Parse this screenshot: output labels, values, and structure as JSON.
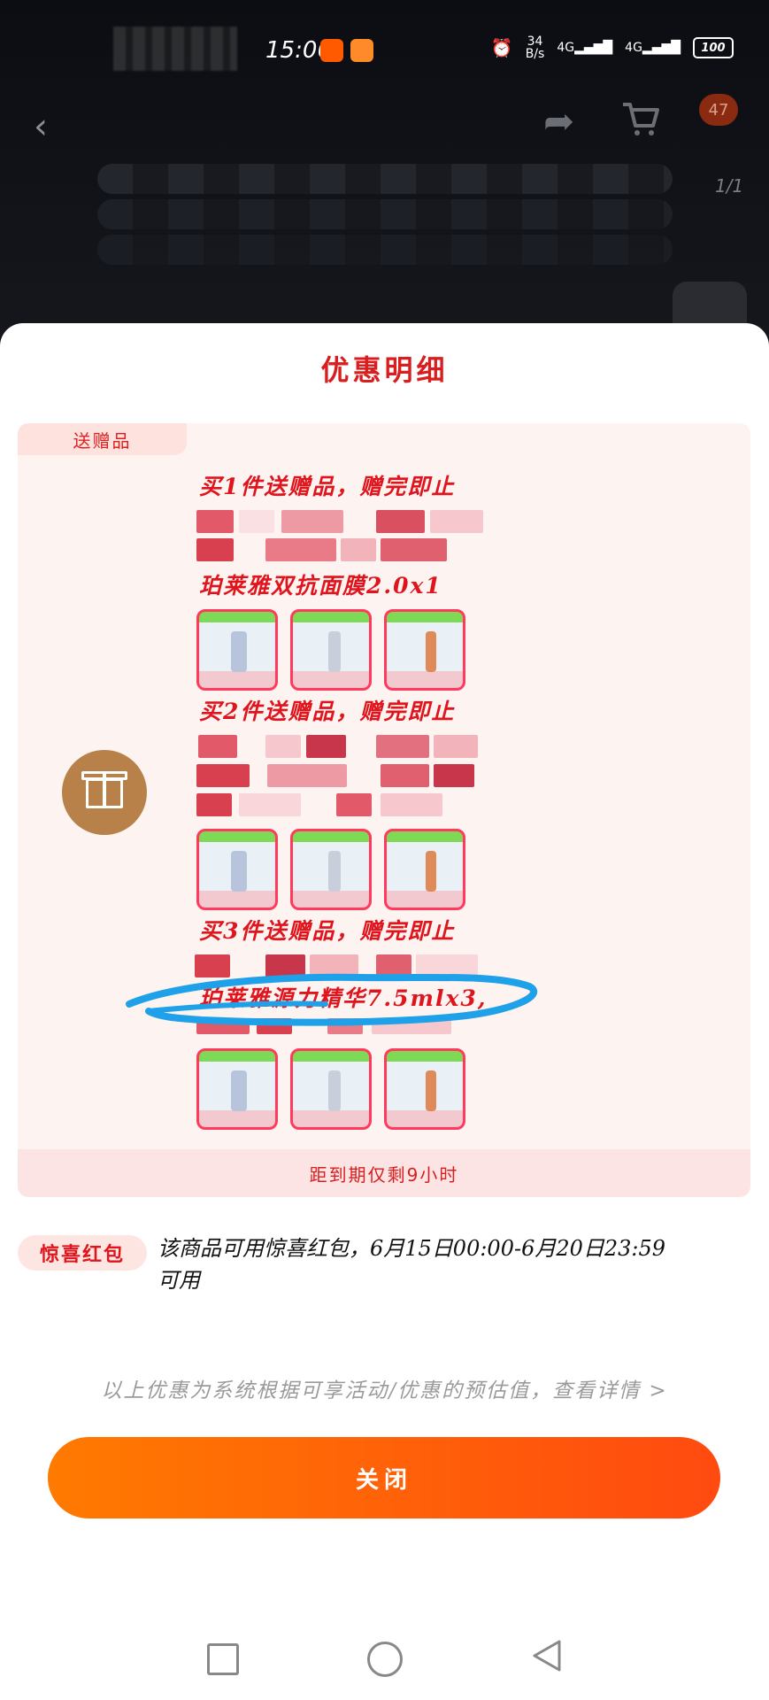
{
  "status_bar": {
    "time": "15:06",
    "net_speed": "34\nB/s",
    "signal_1": "4G",
    "signal_2": "4G",
    "battery": "100"
  },
  "nav": {
    "back_icon": "chevron-left-icon",
    "share_icon": "share-icon",
    "cart_icon": "cart-icon",
    "cart_badge": "47",
    "page_indicator": "1/1"
  },
  "sheet": {
    "title": "优惠明细",
    "gift_section": {
      "tag": "送赠品",
      "tier1_title": "买1件送赠品，赠完即止",
      "tier1_item": "珀莱雅双抗面膜2.0x1",
      "tier2_title": "买2件送赠品，赠完即止",
      "tier3_title": "买3件送赠品，赠完即止",
      "tier3_item": "珀莱雅源力精华7.5mlx3,",
      "footer": "距到期仅剩9小时"
    },
    "hongbao": {
      "tag": "惊喜红包",
      "text": "该商品可用惊喜红包，6月15日00:00-6月20日23:59可用"
    },
    "disclaimer": "以上优惠为系统根据可享活动/优惠的预估值，查看详情 >",
    "close_label": "关闭"
  },
  "colors": {
    "accent_red": "#e0141c",
    "button_start": "#ff7a00",
    "button_end": "#ff4a10",
    "card_bg": "#fdf3f1"
  }
}
